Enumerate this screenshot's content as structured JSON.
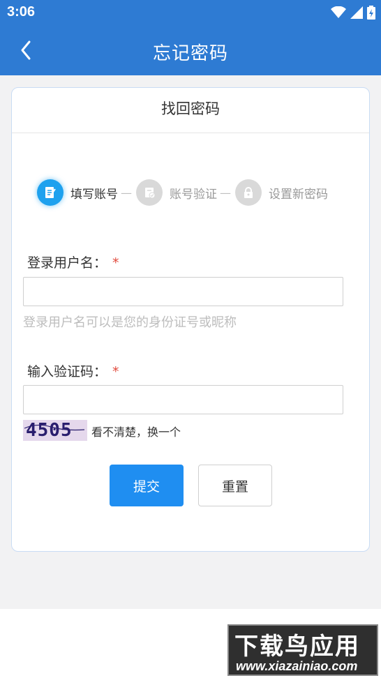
{
  "status_bar": {
    "time": "3:06"
  },
  "header": {
    "title": "忘记密码"
  },
  "card": {
    "title": "找回密码"
  },
  "steps": [
    {
      "label": "填写账号",
      "active": true
    },
    {
      "label": "账号验证",
      "active": false
    },
    {
      "label": "设置新密码",
      "active": false
    }
  ],
  "step_separator": "—",
  "form": {
    "username_label": "登录用户名：",
    "required_mark": "*",
    "username_value": "",
    "username_hint": "登录用户名可以是您的身份证号或昵称",
    "captcha_label": "输入验证码：",
    "captcha_value": "",
    "captcha_image_text": "4505",
    "captcha_refresh": "看不清楚，换一个"
  },
  "buttons": {
    "submit": "提交",
    "reset": "重置"
  },
  "watermark": {
    "title": "下载鸟应用",
    "url": "www.xiazainiao.com"
  },
  "colors": {
    "primary": "#2e7bd3",
    "button": "#1f8ef1",
    "step_active": "#1ea1ee",
    "required": "#e14a3d"
  }
}
